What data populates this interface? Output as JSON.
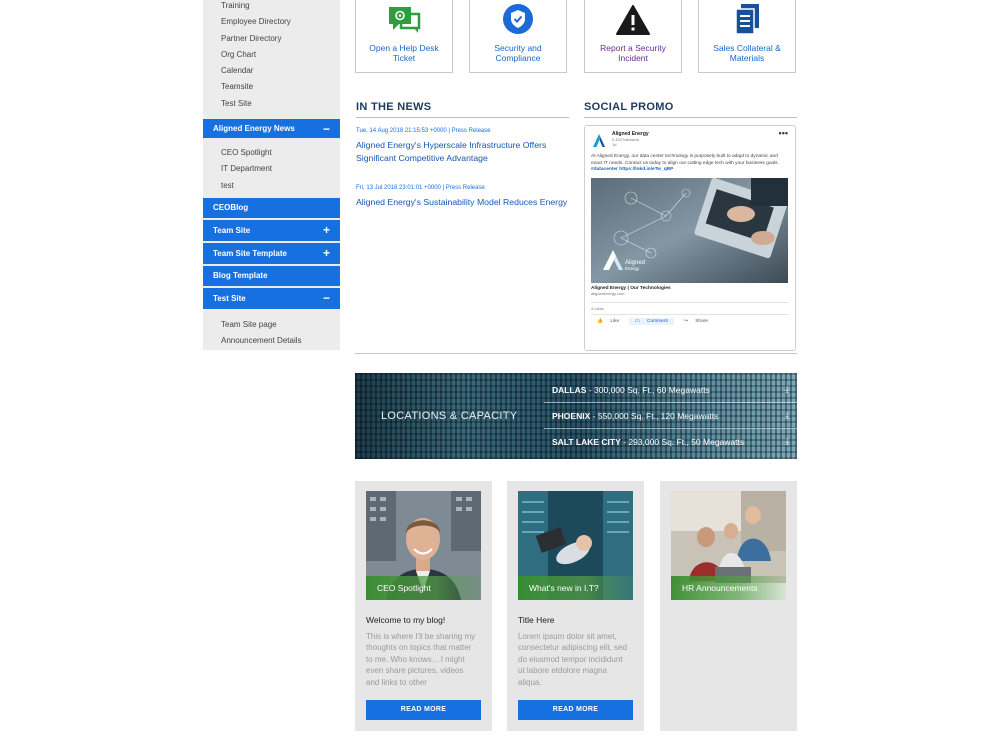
{
  "sidebar": {
    "top_links": [
      "Training",
      "Employee Directory",
      "Partner Directory",
      "Org Chart",
      "Calendar",
      "Teamsite",
      "Test Site"
    ],
    "news_section": {
      "label": "Aligned Energy News",
      "toggle": "−",
      "links": [
        "CEO Spotlight",
        "IT Department",
        "test"
      ]
    },
    "sections": [
      {
        "label": "CEOBlog",
        "toggle": ""
      },
      {
        "label": "Team Site",
        "toggle": "+"
      },
      {
        "label": "Team Site Template",
        "toggle": "+"
      },
      {
        "label": "Blog Template",
        "toggle": ""
      },
      {
        "label": "Test Site",
        "toggle": "−"
      }
    ],
    "test_site_links": [
      "Team Site page",
      "Announcement Details"
    ]
  },
  "tiles": [
    {
      "label": "Open a Help Desk Ticket",
      "icon": "help-desk-chat-icon",
      "color": "#2e9d3e"
    },
    {
      "label": "Security and Compliance",
      "icon": "shield-check-icon",
      "color": "#1a6ad7"
    },
    {
      "label": "Report a Security Incident",
      "icon": "warning-triangle-icon",
      "color": "#1a1a1a"
    },
    {
      "label": "Sales Collateral & Materials",
      "icon": "documents-icon",
      "color": "#1a4f9c"
    }
  ],
  "news": {
    "heading": "IN THE NEWS",
    "items": [
      {
        "meta": "Tue, 14 Aug 2018 21:15:53 +0000 | Press Release",
        "title": "Aligned Energy's Hyperscale Infrastructure Offers Significant Competitive Advantage"
      },
      {
        "meta": "Fri, 13 Jul 2018 23:01:01 +0000 | Press Release",
        "title": "Aligned Energy's Sustainability Model Reduces Energy"
      }
    ]
  },
  "social": {
    "heading": "SOCIAL PROMO",
    "company": "Aligned Energy",
    "followers": "2,422 followers",
    "age": "1d",
    "menu": "•••",
    "text": "At Aligned Energy, our data center technology is purposely built to adapt to dynamic and exact IT needs. Contact us today to align our cutting edge tech with your business goals.",
    "hashtag": "#datacenter",
    "short_link": "https://lnkd.in/eTw_qBP",
    "image_logo": "Aligned",
    "image_logo_sub": "Energy",
    "link_title": "Aligned Energy | Our Technologies",
    "link_url": "alignedenergy.com",
    "likes": "4 Likes",
    "actions": [
      "Like",
      "Comment",
      "Share"
    ]
  },
  "banner": {
    "title": "LOCATIONS & CAPACITY",
    "locations": [
      {
        "city": "DALLAS",
        "detail": " - 300,000 Sq. Ft., 60 Megawatts"
      },
      {
        "city": "PHOENIX",
        "detail": " - 550,000 Sq. Ft., 120 Megawatts"
      },
      {
        "city": "SALT LAKE CITY",
        "detail": " - 293,000 Sq. Ft., 50 Megawatts"
      }
    ]
  },
  "cards": [
    {
      "tag": "CEO Spotlight",
      "title": "Welcome to my blog!",
      "text": "This is where I'll be sharing my thoughts on topics that matter to me. Who knows... I might even share pictures, videos and links to other",
      "button": "READ MORE"
    },
    {
      "tag": "What's new in I.T?",
      "title": "Title Here",
      "text": "Lorem ipsum dolor sit amet, consectetur adipiscing elit, sed do eiusmod tempor incididunt ut labore etdolore magna aliqua.",
      "button": "READ MORE"
    },
    {
      "tag": "HR Announcements",
      "title": "",
      "text": "",
      "button": ""
    }
  ],
  "colors": {
    "primary_blue": "#1770df",
    "news_heading": "#1d3a5c",
    "green_overlay": "#388c2e"
  }
}
